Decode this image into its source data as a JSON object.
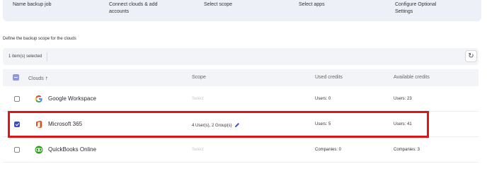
{
  "steps": [
    "Name backup job",
    "Connect clouds & add accounts",
    "Select scope",
    "Select apps",
    "Configure Optional Settings"
  ],
  "section_label": "Define the backup scope for the clouds",
  "selection": {
    "count_text": "1 item(s) selected",
    "refresh_icon": "refresh-icon"
  },
  "table": {
    "headers": {
      "clouds": "Clouds",
      "scope": "Scope",
      "used": "Used credits",
      "available": "Available credits"
    },
    "rows": [
      {
        "name": "Google Workspace",
        "icon": "google-logo-icon",
        "scope": "Select",
        "used": "Users:  0",
        "available": "Users:  23",
        "checked": false
      },
      {
        "name": "Microsoft 365",
        "icon": "office-logo-icon",
        "scope": "4 User(s), 2 Group(s)",
        "used": "Users:  5",
        "available": "Users:  41",
        "checked": true
      },
      {
        "name": "QuickBooks Online",
        "icon": "quickbooks-logo-icon",
        "scope": "Select",
        "used": "Companies:  0",
        "available": "Companies:  3",
        "checked": false
      }
    ]
  },
  "colors": {
    "highlight": "#e01515",
    "accent": "#3a4dbf",
    "header_bg": "#eef0f8"
  }
}
